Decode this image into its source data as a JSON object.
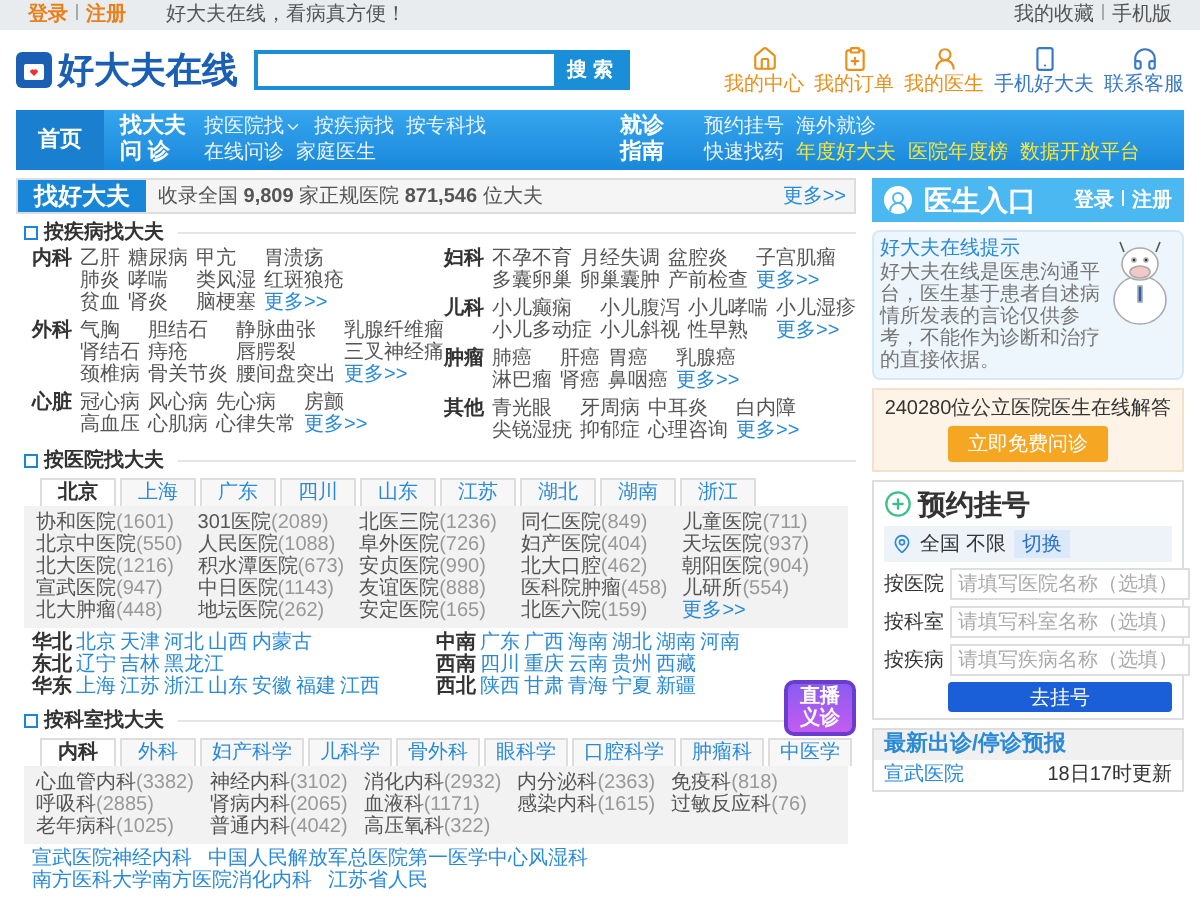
{
  "top_bar": {
    "auth_links": [
      "登录",
      "注册"
    ],
    "slogan": "好大夫在线，看病真方便！",
    "right_links": [
      "我的收藏",
      "手机版"
    ]
  },
  "header": {
    "logo": "好大夫在线",
    "search": {
      "button": "搜 索"
    },
    "shortcuts": [
      {
        "label": "我的中心",
        "kind": "home",
        "color": "#e8901c"
      },
      {
        "label": "我的订单",
        "kind": "order",
        "color": "#e8901c"
      },
      {
        "label": "我的医生",
        "kind": "doctor",
        "color": "#e8901c"
      },
      {
        "label": "手机好大夫",
        "kind": "phone",
        "color": "#3a78c8"
      },
      {
        "label": "联系客服",
        "kind": "service",
        "color": "#3a78c8"
      }
    ]
  },
  "nav": {
    "home": "首页",
    "sections": [
      {
        "label": "找大夫",
        "links": [
          {
            "text": "按医院找",
            "dropdown": true,
            "highlight": false
          },
          {
            "text": "按疾病找",
            "dropdown": false,
            "highlight": false
          },
          {
            "text": "按专科找",
            "dropdown": false,
            "highlight": false
          }
        ]
      },
      {
        "label": "就诊",
        "links": [
          {
            "text": "预约挂号",
            "dropdown": false,
            "highlight": false
          },
          {
            "text": "海外就诊",
            "dropdown": false,
            "highlight": false
          }
        ]
      },
      {
        "label": "问 诊",
        "links": [
          {
            "text": "在线问诊",
            "dropdown": false,
            "highlight": false
          },
          {
            "text": "家庭医生",
            "dropdown": false,
            "highlight": false
          }
        ]
      },
      {
        "label": "指南",
        "links": [
          {
            "text": "快速找药",
            "dropdown": false,
            "highlight": false
          },
          {
            "text": "年度好大夫",
            "dropdown": false,
            "highlight": true
          },
          {
            "text": "医院年度榜",
            "dropdown": false,
            "highlight": true
          },
          {
            "text": "数据开放平台",
            "dropdown": false,
            "highlight": true
          }
        ]
      }
    ]
  },
  "find_doctor": {
    "tab": "找好大夫",
    "summary": "收录全国 **9,809** 家正规医院 **871,546** 位大夫",
    "more": "更多>>"
  },
  "by_disease": {
    "title": "按疾病找大夫",
    "columns": [
      [
        {
          "label": "内科",
          "rows": [
            [
              "乙肝",
              "糖尿病",
              "甲亢",
              "胃溃疡"
            ],
            [
              "肺炎",
              "哮喘",
              "类风湿",
              "红斑狼疮"
            ],
            [
              "贫血",
              "肾炎",
              "脑梗塞"
            ]
          ],
          "more": "更多>>"
        },
        {
          "label": "外科",
          "rows": [
            [
              "气胸",
              "胆结石",
              "静脉曲张",
              "乳腺纤维瘤"
            ],
            [
              "肾结石",
              "痔疮",
              "唇腭裂",
              "三叉神经痛"
            ],
            [
              "颈椎病",
              "骨关节炎",
              "腰间盘突出"
            ]
          ],
          "more": "更多>>"
        },
        {
          "label": "心脏",
          "rows": [
            [
              "冠心病",
              "风心病",
              "先心病",
              "房颤"
            ],
            [
              "高血压",
              "心肌病",
              "心律失常"
            ]
          ],
          "more": "更多>>"
        }
      ],
      [
        {
          "label": "妇科",
          "rows": [
            [
              "不孕不育",
              "月经失调",
              "盆腔炎",
              "子宫肌瘤"
            ],
            [
              "多囊卵巢",
              "卵巢囊肿",
              "产前检查"
            ]
          ],
          "more": "更多>>"
        },
        {
          "label": "儿科",
          "rows": [
            [
              "小儿癫痫",
              "小儿腹泻",
              "小儿哮喘",
              "小儿湿疹"
            ],
            [
              "小儿多动症",
              "小儿斜视",
              "性早熟"
            ]
          ],
          "more": "更多>>"
        },
        {
          "label": "肿瘤",
          "rows": [
            [
              "肺癌",
              "肝癌",
              "胃癌",
              "乳腺癌"
            ],
            [
              "淋巴瘤",
              "肾癌",
              "鼻咽癌"
            ]
          ],
          "more": "更多>>"
        },
        {
          "label": "其他",
          "rows": [
            [
              "青光眼",
              "牙周病",
              "中耳炎",
              "白内障"
            ],
            [
              "尖锐湿疣",
              "抑郁症",
              "心理咨询"
            ]
          ],
          "more": "更多>>"
        }
      ]
    ]
  },
  "by_hospital": {
    "title": "按医院找大夫",
    "tabs": [
      {
        "label": "北京",
        "selected": true
      },
      {
        "label": "上海",
        "selected": false
      },
      {
        "label": "广东",
        "selected": false
      },
      {
        "label": "四川",
        "selected": false
      },
      {
        "label": "山东",
        "selected": false
      },
      {
        "label": "江苏",
        "selected": false
      },
      {
        "label": "湖北",
        "selected": false
      },
      {
        "label": "湖南",
        "selected": false
      },
      {
        "label": "浙江",
        "selected": false
      }
    ],
    "hospitals": [
      {
        "name": "协和医院",
        "count": "(1601)"
      },
      {
        "name": "301医院",
        "count": "(2089)"
      },
      {
        "name": "北医三院",
        "count": "(1236)"
      },
      {
        "name": "同仁医院",
        "count": "(849)"
      },
      {
        "name": "儿童医院",
        "count": "(711)"
      },
      {
        "name": "北京中医院",
        "count": "(550)"
      },
      {
        "name": "人民医院",
        "count": "(1088)"
      },
      {
        "name": "阜外医院",
        "count": "(726)"
      },
      {
        "name": "妇产医院",
        "count": "(404)"
      },
      {
        "name": "天坛医院",
        "count": "(937)"
      },
      {
        "name": "北大医院",
        "count": "(1216)"
      },
      {
        "name": "积水潭医院",
        "count": "(673)"
      },
      {
        "name": "安贞医院",
        "count": "(990)"
      },
      {
        "name": "北大口腔",
        "count": "(462)"
      },
      {
        "name": "朝阳医院",
        "count": "(904)"
      },
      {
        "name": "宣武医院",
        "count": "(947)"
      },
      {
        "name": "中日医院",
        "count": "(1143)"
      },
      {
        "name": "友谊医院",
        "count": "(888)"
      },
      {
        "name": "医科院肿瘤",
        "count": "(458)"
      },
      {
        "name": "儿研所",
        "count": "(554)"
      },
      {
        "name": "北大肿瘤",
        "count": "(448)"
      },
      {
        "name": "地坛医院",
        "count": "(262)"
      },
      {
        "name": "安定医院",
        "count": "(165)"
      },
      {
        "name": "北医六院",
        "count": "(159)"
      }
    ],
    "more": "更多>>",
    "regions": [
      {
        "label": "华北",
        "places": [
          "北京",
          "天津",
          "河北",
          "山西",
          "内蒙古"
        ]
      },
      {
        "label": "中南",
        "places": [
          "广东",
          "广西",
          "海南",
          "湖北",
          "湖南",
          "河南"
        ]
      },
      {
        "label": "东北",
        "places": [
          "辽宁",
          "吉林",
          "黑龙江"
        ]
      },
      {
        "label": "西南",
        "places": [
          "四川",
          "重庆",
          "云南",
          "贵州",
          "西藏"
        ]
      },
      {
        "label": "华东",
        "places": [
          "上海",
          "江苏",
          "浙江",
          "山东",
          "安徽",
          "福建",
          "江西"
        ]
      },
      {
        "label": "西北",
        "places": [
          "陕西",
          "甘肃",
          "青海",
          "宁夏",
          "新疆"
        ]
      }
    ]
  },
  "by_department": {
    "title": "按科室找大夫",
    "tabs": [
      {
        "label": "内科",
        "selected": true
      },
      {
        "label": "外科",
        "selected": false
      },
      {
        "label": "妇产科学",
        "selected": false
      },
      {
        "label": "儿科学",
        "selected": false
      },
      {
        "label": "骨外科",
        "selected": false
      },
      {
        "label": "眼科学",
        "selected": false
      },
      {
        "label": "口腔科学",
        "selected": false
      },
      {
        "label": "肿瘤科",
        "selected": false
      },
      {
        "label": "中医学",
        "selected": false
      }
    ],
    "live_badge": [
      "直播",
      "义诊"
    ],
    "departments": [
      {
        "name": "心血管内科",
        "count": "(3382)"
      },
      {
        "name": "神经内科",
        "count": "(3102)"
      },
      {
        "name": "消化内科",
        "count": "(2932)"
      },
      {
        "name": "内分泌科",
        "count": "(2363)"
      },
      {
        "name": "免疫科",
        "count": "(818)"
      },
      {
        "name": "呼吸科",
        "count": "(2885)"
      },
      {
        "name": "肾病内科",
        "count": "(2065)"
      },
      {
        "name": "血液科",
        "count": "(1171)"
      },
      {
        "name": "感染内科",
        "count": "(1615)"
      },
      {
        "name": "过敏反应科",
        "count": "(76)"
      },
      {
        "name": "老年病科",
        "count": "(1025)"
      },
      {
        "name": "普通内科",
        "count": "(4042)"
      },
      {
        "name": "高压氧科",
        "count": "(322)"
      }
    ],
    "featured_links": [
      "宣武医院神经内科",
      "中国人民解放军总医院第一医学中心风湿科",
      "南方医科大学南方医院消化内科",
      "江苏省人民"
    ]
  },
  "doctor_entry": {
    "title": "医生入口",
    "links": [
      "登录",
      "注册"
    ]
  },
  "tip": {
    "title": "好大夫在线提示",
    "text": "好大夫在线是医患沟通平台，医生基于患者自述病情所发表的言论仅供参考，不能作为诊断和治疗的直接依据。"
  },
  "answer_promo": {
    "text": "240280位公立医院医生在线解答",
    "button": "立即免费问诊"
  },
  "booking": {
    "title": "预约挂号",
    "location": "全国 不限",
    "switch": "切换",
    "fields": [
      {
        "label": "按医院",
        "placeholder": "请填写医院名称（选填）"
      },
      {
        "label": "按科室",
        "placeholder": "请填写科室名称（选填）"
      },
      {
        "label": "按疾病",
        "placeholder": "请填写疾病名称（选填）"
      }
    ],
    "button": "去挂号"
  },
  "schedule": {
    "title": "最新出诊/停诊预报",
    "rows": [
      {
        "hospital": "宣武医院",
        "updated": "18日17时更新"
      }
    ]
  }
}
